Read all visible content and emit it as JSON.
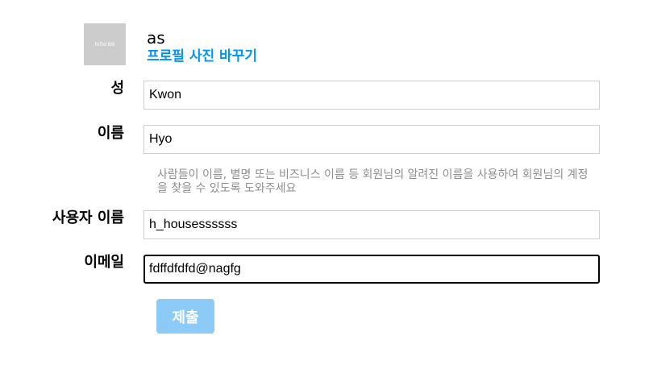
{
  "profile": {
    "avatar_text": "Rifle'BB",
    "username": "as",
    "change_photo_label": "프로필 사진 바꾸기"
  },
  "form": {
    "last_name": {
      "label": "성",
      "value": "Kwon"
    },
    "first_name": {
      "label": "이름",
      "value": "Hyo"
    },
    "name_hint": "사람들이 이름, 별명 또는 비즈니스 이름 등 회원님의 알려진 이름을 사용하여 회원님의 계정을 찾을 수 있도록 도와주세요",
    "username": {
      "label": "사용자 이름",
      "value": "h_housessssss"
    },
    "email": {
      "label": "이메일",
      "value": "fdffdfdfd@nagfg"
    },
    "submit_label": "제출"
  },
  "colors": {
    "link": "#0095f6",
    "submit_bg": "#8ccbf7",
    "hint": "#8e8e8e"
  }
}
